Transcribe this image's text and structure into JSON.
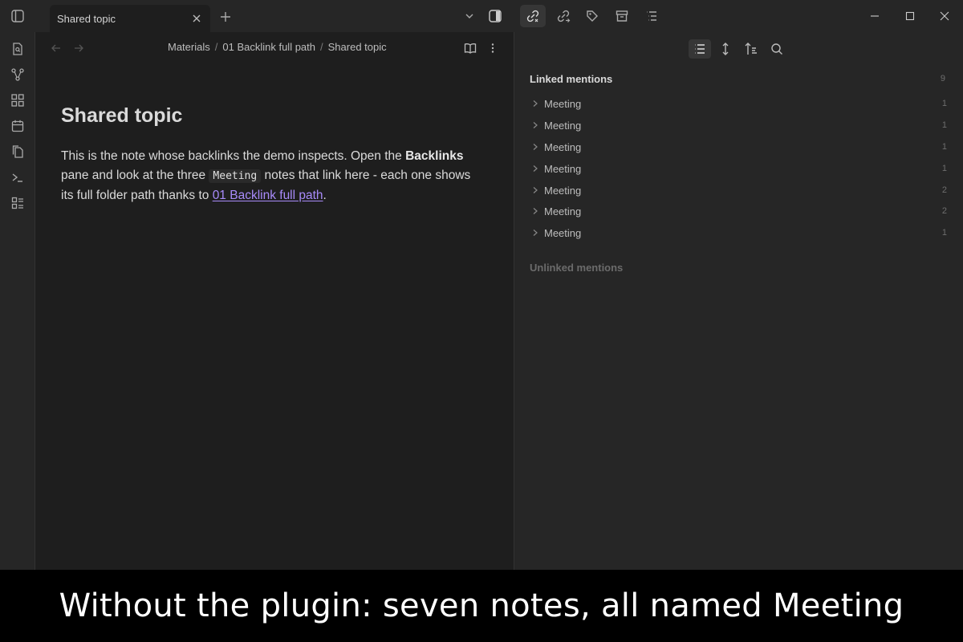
{
  "tab": {
    "title": "Shared topic"
  },
  "breadcrumb": [
    "Materials",
    "01 Backlink full path",
    "Shared topic"
  ],
  "note": {
    "title": "Shared topic",
    "body_1": "This is the note whose backlinks the demo inspects. Open the ",
    "body_bold": "Backlinks",
    "body_2": " pane and look at the three ",
    "body_code": "Meeting",
    "body_3": " notes that link here - each one shows its full folder path thanks to ",
    "body_link": "01 Backlink full path",
    "body_4": "."
  },
  "backlinks": {
    "linked_label": "Linked mentions",
    "linked_count": "9",
    "mentions": [
      {
        "title": "Meeting",
        "count": "1"
      },
      {
        "title": "Meeting",
        "count": "1"
      },
      {
        "title": "Meeting",
        "count": "1"
      },
      {
        "title": "Meeting",
        "count": "1"
      },
      {
        "title": "Meeting",
        "count": "2"
      },
      {
        "title": "Meeting",
        "count": "2"
      },
      {
        "title": "Meeting",
        "count": "1"
      }
    ],
    "unlinked_label": "Unlinked mentions"
  },
  "caption": "Without the plugin: seven notes, all named Meeting",
  "colors": {
    "link": "#a88bfa",
    "background": "#1e1e1e",
    "sidebar": "#262626"
  }
}
